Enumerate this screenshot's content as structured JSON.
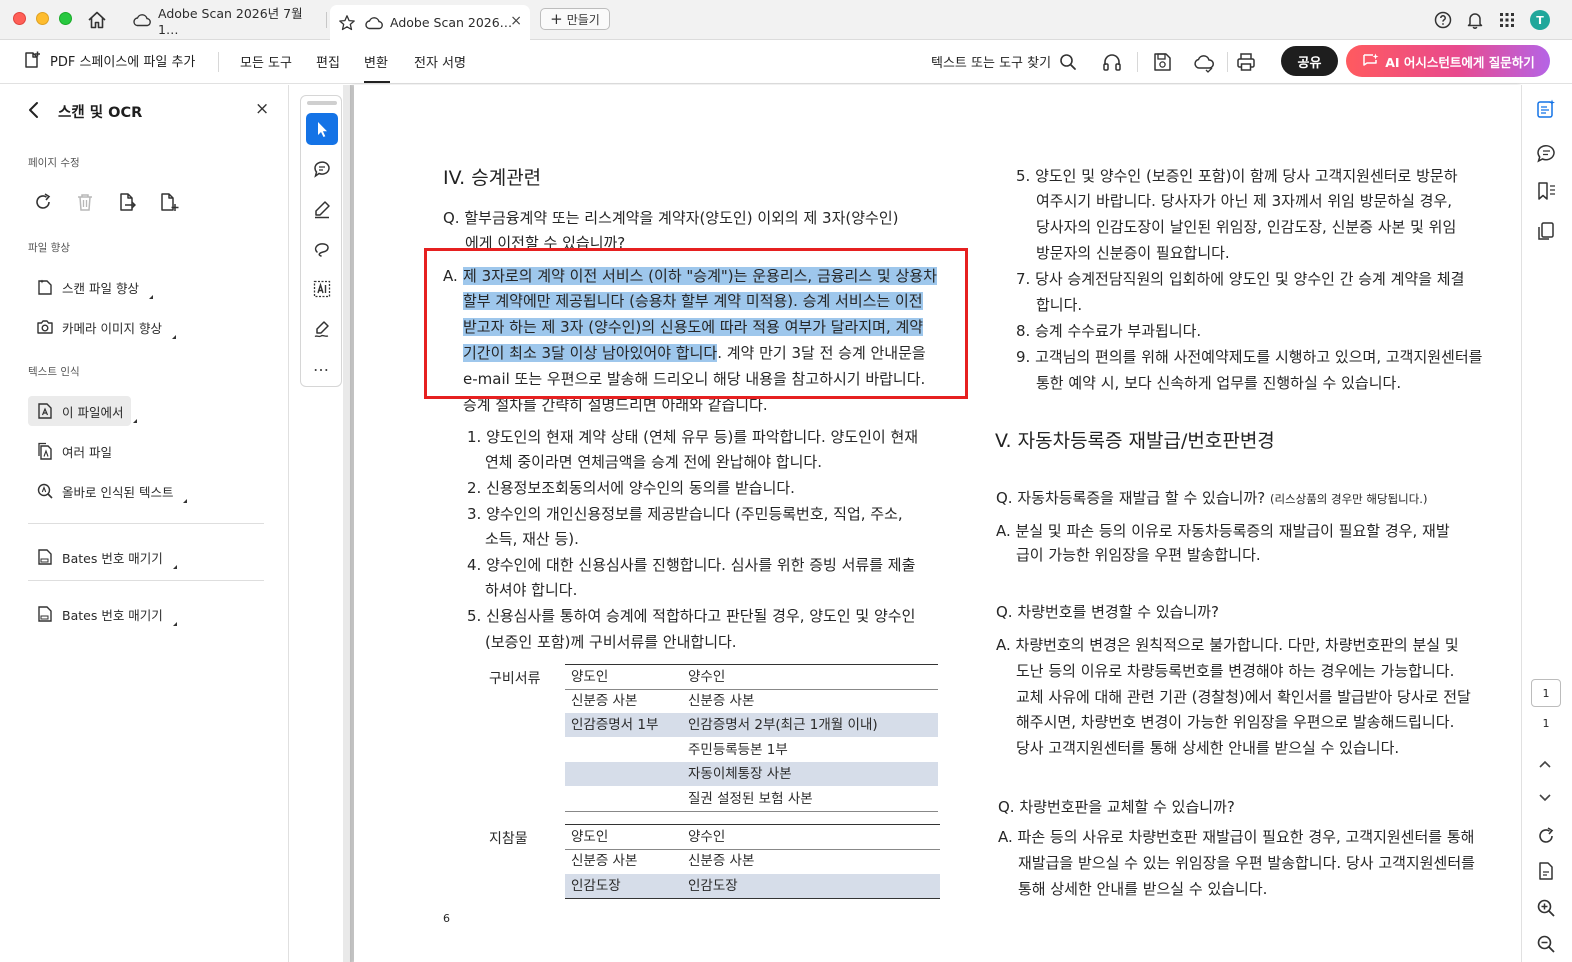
{
  "titlebar": {
    "tab1_title": "Adobe Scan 2026년 7월 1…",
    "tab2_title": "Adobe Scan 2026…",
    "tab2_close": "×",
    "new_tab_label": "만들기",
    "avatar_initial": "T"
  },
  "toolbar": {
    "add_to_pdf_space": "PDF 스페이스에 파일 추가",
    "menu": [
      "모든 도구",
      "편집",
      "변환",
      "전자 서명"
    ],
    "active_menu": "변환",
    "find_placeholder": "텍스트 또는 도구 찾기",
    "share_label": "공유",
    "ai_label": "AI 어시스턴트에게 질문하기"
  },
  "left_panel": {
    "title": "스캔 및 OCR",
    "close": "×",
    "section_page_edit": "페이지 수정",
    "section_file_enhance": "파일 향상",
    "enhance_scan": "스캔 파일 향상",
    "enhance_camera": "카메라 이미지 향상",
    "section_text_recognition": "텍스트 인식",
    "in_this_file": "이 파일에서",
    "multiple_files": "여러 파일",
    "correct_recognized": "올바로 인식된 텍스트",
    "bates_1": "Bates 번호 매기기",
    "bates_2": "Bates 번호 매기기"
  },
  "toolstrip": {
    "more": "…"
  },
  "document": {
    "left": {
      "heading": "IV. 승계관련",
      "q_line1": "Q. 할부금융계약 또는 리스계약을 계약자(양도인) 이외의 제 3자(양수인)",
      "q_line2": "에게 이전할 수 있습니까?",
      "a_prefix": "A.",
      "a_hl1": "제 3자로의 계약 이전 서비스 (이하 \"승계\")는 운용리스, 금융리스 및 상용차",
      "a_hl2": "할부 계약에만 제공됩니다 (승용차 할부 계약 미적용). 승계 서비스는 이전",
      "a_hl3": "받고자 하는 제 3자 (양수인)의 신용도에 따라 적용 여부가 달라지며, 계약",
      "a_hl4": "기간이 최소 3달 이상 남아있어야 합니다",
      "a_rest4": ". 계약 만기 3달 전 승계 안내문을",
      "a_line5": "e-mail 또는 우편으로 발송해 드리오니 해당 내용을 참고하시기 바랍니다.",
      "a_line6": "승계 절차를 간략히 설명드리면 아래와 같습니다.",
      "steps": [
        "1. 양도인의 현재 계약 상태 (연체 유무 등)를 파악합니다. 양도인이 현재",
        "연체 중이라면 연체금액을 승계 전에 완납해야 합니다.",
        "2. 신용정보조회동의서에 양수인의 동의를 받습니다.",
        "3. 양수인의 개인신용정보를 제공받습니다 (주민등록번호, 직업, 주소,",
        "소득, 재산 등).",
        "4. 양수인에 대한 신용심사를 진행합니다. 심사를 위한 증빙 서류를 제출",
        "하셔야 합니다.",
        "5. 신용심사를 통하여 승계에 적합하다고 판단될 경우, 양도인 및 양수인",
        "(보증인 포함)께 구비서류를 안내합니다."
      ],
      "table1": {
        "label": "구비서류",
        "rows": [
          [
            "양도인",
            "양수인"
          ],
          [
            "신분증 사본",
            "신분증 사본"
          ],
          [
            "인감증명서 1부",
            "인감증명서 2부(최근 1개월 이내)"
          ],
          [
            "",
            "주민등록등본 1부"
          ],
          [
            "",
            "자동이체통장 사본"
          ],
          [
            "",
            "질권 설정된 보험 사본"
          ]
        ]
      },
      "table2": {
        "label": "지참물",
        "rows": [
          [
            "양도인",
            "양수인"
          ],
          [
            "신분증 사본",
            "신분증 사본"
          ],
          [
            "인감도장",
            "인감도장"
          ]
        ]
      },
      "page_number": "6"
    },
    "right": {
      "lines_top": [
        "5. 양도인 및 양수인 (보증인 포함)이 함께 당사 고객지원센터로 방문하",
        "여주시기 바랍니다. 당사자가 아닌 제 3자께서 위임 방문하실 경우,",
        "당사자의 인감도장이 날인된 위임장, 인감도장, 신분증 사본 및 위임",
        "방문자의 신분증이 필요합니다.",
        "7. 당사 승계전담직원의 입회하에 양도인 및 양수인 간 승계 계약을 체결",
        "합니다.",
        "8. 승계 수수료가 부과됩니다.",
        "9. 고객님의 편의를 위해 사전예약제도를 시행하고 있으며, 고객지원센터를",
        "통한 예약 시, 보다 신속하게 업무를 진행하실 수 있습니다."
      ],
      "heading": "V. 자동차등록증 재발급/번호판변경",
      "q1": "Q. 자동차등록증을 재발급 할 수 있습니까?",
      "q1_note": "(리스상품의 경우만 해당됩니다.)",
      "a1": [
        "A. 분실 및 파손 등의 이유로 자동차등록증의 재발급이 필요할 경우, 재발",
        "급이 가능한 위임장을 우편 발송합니다."
      ],
      "q2": "Q. 차량번호를 변경할 수 있습니까?",
      "a2": [
        "A. 차량번호의 변경은 원칙적으로 불가합니다. 다만, 차량번호판의 분실 및",
        "도난 등의 이유로 차량등록번호를 변경해야 하는 경우에는 가능합니다.",
        "교체 사유에 대해 관련 기관 (경찰청)에서 확인서를 발급받아 당사로 전달",
        "해주시면, 차량번호 변경이 가능한 위임장을 우편으로 발송해드립니다.",
        "당사 고객지원센터를 통해 상세한 안내를 받으실 수 있습니다."
      ],
      "q3": "Q. 차량번호판을 교체할 수 있습니까?",
      "a3": [
        "A. 파손 등의 사유로 차량번호판 재발급이 필요한 경우, 고객지원센터를 통해",
        "재발급을 받으실 수 있는 위임장을 우편 발송합니다. 당사 고객지원센터를",
        "통해 상세한 안내를 받으실 수 있습니다."
      ]
    }
  },
  "right_rail": {
    "current_page": "1",
    "total_pages": "1",
    "chev_up": "⌃",
    "chev_down": "⌄"
  },
  "colors": {
    "accent_blue": "#1473e6",
    "selection_highlight": "#9ec7ec",
    "annotation_red": "#e62020",
    "ai_gradient_start": "#ff5a5f",
    "ai_gradient_end": "#b564e6"
  }
}
